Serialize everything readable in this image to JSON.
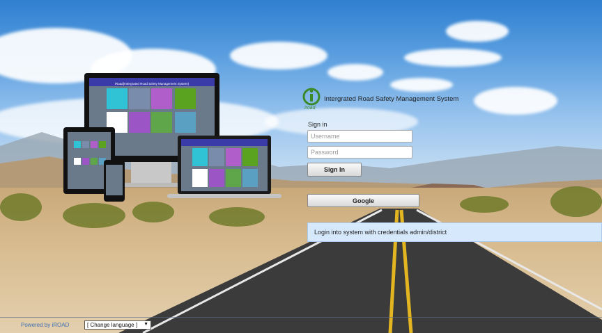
{
  "brand": {
    "logo_caption": "iroad",
    "title": "Intergrated Road Safety Management System"
  },
  "device_banner": "iRoad(Intergrated Road Safety Management System)",
  "login": {
    "heading": "Sign in",
    "username_placeholder": "Username",
    "password_placeholder": "Password",
    "signin_button": "Sign In",
    "google_button": "Google"
  },
  "info": {
    "message": "Login into system with credentials admin/district"
  },
  "footer": {
    "powered_by": "Powered by iROAD",
    "language_select": "[ Change language ]"
  },
  "colors": {
    "sky": "#5b9fe0",
    "info_bg": "#d6e8fb",
    "logo_green": "#3a8a2a",
    "footer_link": "#3b6fb0"
  }
}
